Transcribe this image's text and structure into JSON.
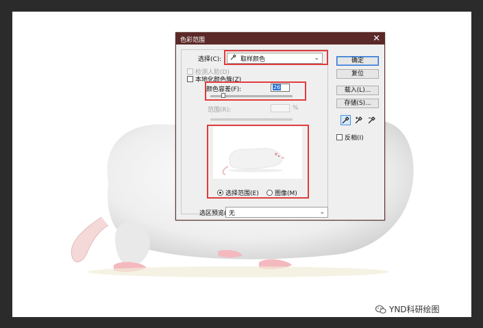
{
  "dialog": {
    "title": "色彩范围",
    "close": "✕",
    "select_label": "选择(C):",
    "select_value": "取样颜色",
    "detect_faces": "检测人脸(D)",
    "localized_clusters": "本地化颜色簇(Z)",
    "fuzziness_label": "颜色容差(F):",
    "fuzziness_value": "26",
    "range_label": "范围(R):",
    "range_unit": "%",
    "radio_selection": "选择范围(E)",
    "radio_image": "图像(M)",
    "preview_label": "选区预览(T):",
    "preview_value": "无",
    "buttons": {
      "ok": "确定",
      "reset": "复位",
      "load": "载入(L)...",
      "save": "存储(S)..."
    },
    "invert": "反相(I)"
  },
  "watermark": "YND科研绘图",
  "colors": {
    "titlebar": "#5b2a28",
    "highlight": "#e03a3a",
    "accent": "#2a72d2"
  }
}
